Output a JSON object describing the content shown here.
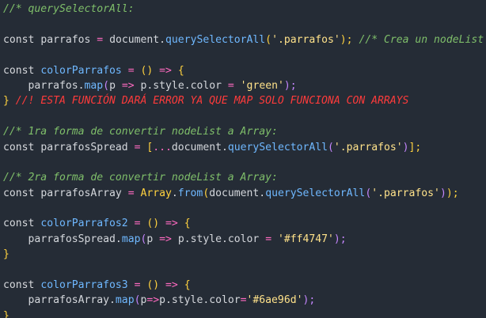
{
  "code": {
    "l1": "//* querySelectorAll:",
    "l2_kw": "const",
    "l2_name": "parrafos",
    "l2_eq": "=",
    "l2_obj": "document",
    "l2_dot": ".",
    "l2_method": "querySelectorAll",
    "l2_po": "(",
    "l2_str": "'.parrafos'",
    "l2_pc": ");",
    "l2_comment": "//* Crea un nodeList",
    "l4_kw": "const",
    "l4_fn": "colorParrafos",
    "l4_eq": "=",
    "l4_pp": "()",
    "l4_arrow": "=>",
    "l4_brace": "{",
    "l5_obj": "parrafos",
    "l5_dot": ".",
    "l5_method": "map",
    "l5_po": "(",
    "l5_p": "p",
    "l5_arrow": "=>",
    "l5_rest": "p.style.color",
    "l5_eq": "=",
    "l5_str": "'green'",
    "l5_pc": ");",
    "l6_brace": "}",
    "l6_err": "//! ESTA FUNCIÓN DARÁ ERROR YA QUE MAP SOLO FUNCIONA CON ARRAYS",
    "l8": "//* 1ra forma de convertir nodeList a Array:",
    "l9_kw": "const",
    "l9_name": "parrafosSpread",
    "l9_eq": "=",
    "l9_bo": "[",
    "l9_spread": "...",
    "l9_obj": "document",
    "l9_dot": ".",
    "l9_method": "querySelectorAll",
    "l9_po": "(",
    "l9_str": "'.parrafos'",
    "l9_pc": ")",
    "l9_bc": "];",
    "l11": "//* 2ra forma de convertir nodeList a Array:",
    "l12_kw": "const",
    "l12_name": "parrafosArray",
    "l12_eq": "=",
    "l12_ctor": "Array",
    "l12_dot": ".",
    "l12_method": "from",
    "l12_po": "(",
    "l12_obj": "document",
    "l12_dot2": ".",
    "l12_method2": "querySelectorAll",
    "l12_po2": "(",
    "l12_str": "'.parrafos'",
    "l12_pc2": ")",
    "l12_pc": ");",
    "l14_kw": "const",
    "l14_fn": "colorParrafos2",
    "l14_eq": "=",
    "l14_pp": "()",
    "l14_arrow": "=>",
    "l14_brace": "{",
    "l15_obj": "parrafosSpread",
    "l15_dot": ".",
    "l15_method": "map",
    "l15_po": "(",
    "l15_p": "p",
    "l15_arrow": "=>",
    "l15_rest": "p.style.color",
    "l15_eq": "=",
    "l15_str": "'#ff4747'",
    "l15_pc": ");",
    "l16_brace": "}",
    "l18_kw": "const",
    "l18_fn": "colorParrafos3",
    "l18_eq": "=",
    "l18_pp": "()",
    "l18_arrow": "=>",
    "l18_brace": "{",
    "l19_obj": "parrafosArray",
    "l19_dot": ".",
    "l19_method": "map",
    "l19_po": "(",
    "l19_p": "p",
    "l19_arrow": "=>",
    "l19_rest": "p.style.color",
    "l19_eq": "=",
    "l19_str": "'#6ae96d'",
    "l19_pc": ");",
    "l20_brace": "}"
  }
}
